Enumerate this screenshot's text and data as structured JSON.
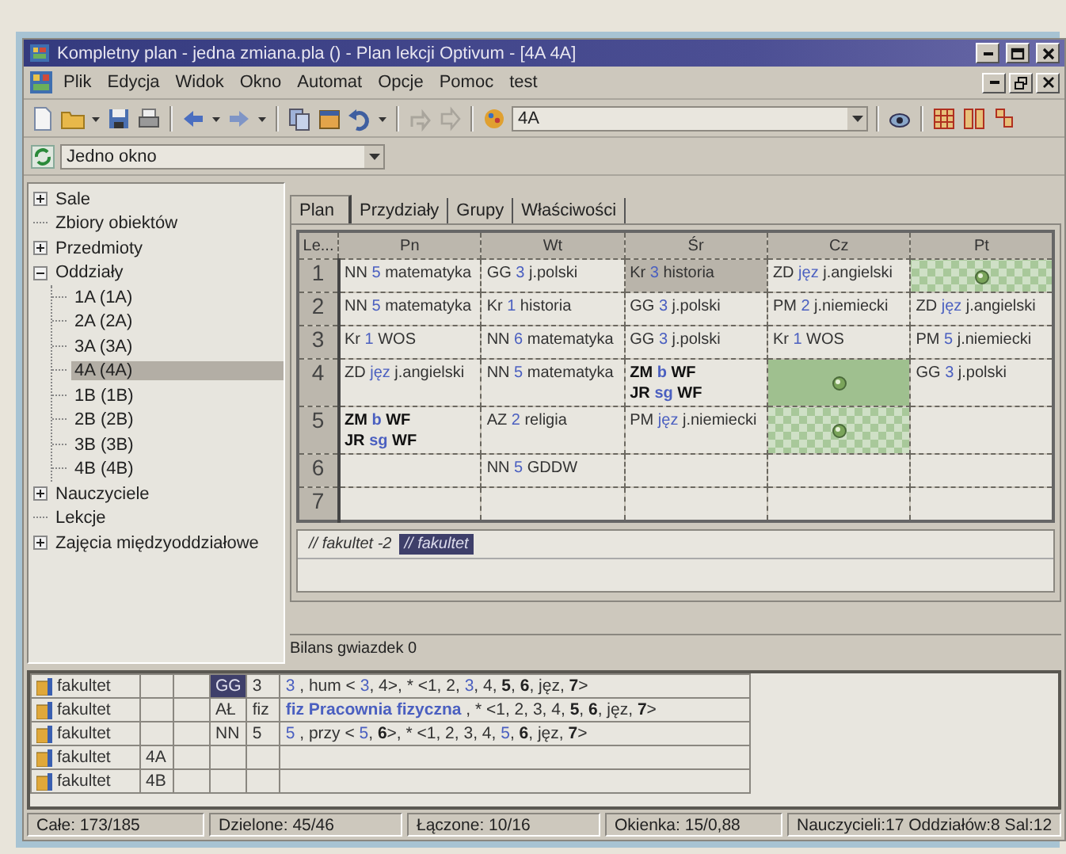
{
  "window": {
    "title": "Kompletny plan - jedna zmiana.pla () - Plan lekcji Optivum - [4A 4A]"
  },
  "menu": [
    "Plik",
    "Edycja",
    "Widok",
    "Okno",
    "Automat",
    "Opcje",
    "Pomoc",
    "test"
  ],
  "toolbar": {
    "class_combo": "4A"
  },
  "toolbar_2": {
    "window_combo": "Jedno okno"
  },
  "tree": {
    "items": [
      {
        "label": "Sale",
        "kind": "group",
        "expanded": false,
        "selected": false
      },
      {
        "label": "Zbiory obiektów",
        "kind": "leaf",
        "selected": false
      },
      {
        "label": "Przedmioty",
        "kind": "group",
        "expanded": false,
        "selected": false
      },
      {
        "label": "Oddziały",
        "kind": "group",
        "expanded": true,
        "selected": false,
        "children": [
          {
            "label": "1A (1A)",
            "selected": false
          },
          {
            "label": "2A (2A)",
            "selected": false
          },
          {
            "label": "3A (3A)",
            "selected": false
          },
          {
            "label": "4A (4A)",
            "selected": true
          },
          {
            "label": "1B (1B)",
            "selected": false
          },
          {
            "label": "2B (2B)",
            "selected": false
          },
          {
            "label": "3B (3B)",
            "selected": false
          },
          {
            "label": "4B (4B)",
            "selected": false
          }
        ]
      },
      {
        "label": "Nauczyciele",
        "kind": "group",
        "expanded": false,
        "selected": false
      },
      {
        "label": "Lekcje",
        "kind": "leaf",
        "selected": false
      },
      {
        "label": "Zajęcia międzyoddziałowe",
        "kind": "group",
        "expanded": false,
        "selected": false
      }
    ]
  },
  "tabs": [
    {
      "label": "Plan",
      "selected": true
    },
    {
      "label": "Przydziały",
      "selected": false
    },
    {
      "label": "Grupy",
      "selected": false
    },
    {
      "label": "Właściwości",
      "selected": false
    }
  ],
  "plan": {
    "corner": "Le...",
    "columns": [
      "Pn",
      "Wt",
      "Śr",
      "Cz",
      "Pt"
    ],
    "rows": [
      {
        "label": "1",
        "cells": [
          {
            "kind": "lesson",
            "selected": false,
            "lines": [
              {
                "teacher": "NN",
                "group": "5",
                "subject": "matematyka",
                "bold": false
              }
            ]
          },
          {
            "kind": "lesson",
            "selected": false,
            "lines": [
              {
                "teacher": "GG",
                "group": "3",
                "subject": "j.polski",
                "bold": false
              }
            ]
          },
          {
            "kind": "lesson",
            "selected": true,
            "lines": [
              {
                "teacher": "Kr",
                "group": "3",
                "subject": "historia",
                "bold": false
              }
            ]
          },
          {
            "kind": "lesson",
            "selected": false,
            "lines": [
              {
                "teacher": "ZD",
                "group": "jęz",
                "subject": "j.angielski",
                "bold": false
              }
            ]
          },
          {
            "kind": "marker",
            "selected": false,
            "checkered": true
          }
        ]
      },
      {
        "label": "2",
        "cells": [
          {
            "kind": "lesson",
            "selected": false,
            "lines": [
              {
                "teacher": "NN",
                "group": "5",
                "subject": "matematyka",
                "bold": false
              }
            ]
          },
          {
            "kind": "lesson",
            "selected": false,
            "lines": [
              {
                "teacher": "Kr",
                "group": "1",
                "subject": "historia",
                "bold": false
              }
            ]
          },
          {
            "kind": "lesson",
            "selected": false,
            "lines": [
              {
                "teacher": "GG",
                "group": "3",
                "subject": "j.polski",
                "bold": false
              }
            ]
          },
          {
            "kind": "lesson",
            "selected": false,
            "lines": [
              {
                "teacher": "PM",
                "group": "2",
                "subject": "j.niemiecki",
                "bold": false
              }
            ]
          },
          {
            "kind": "lesson",
            "selected": false,
            "lines": [
              {
                "teacher": "ZD",
                "group": "jęz",
                "subject": "j.angielski",
                "bold": false
              }
            ]
          }
        ]
      },
      {
        "label": "3",
        "cells": [
          {
            "kind": "lesson",
            "selected": false,
            "lines": [
              {
                "teacher": "Kr",
                "group": "1",
                "subject": "WOS",
                "bold": false
              }
            ]
          },
          {
            "kind": "lesson",
            "selected": false,
            "lines": [
              {
                "teacher": "NN",
                "group": "6",
                "subject": "matematyka",
                "bold": false
              }
            ]
          },
          {
            "kind": "lesson",
            "selected": false,
            "lines": [
              {
                "teacher": "GG",
                "group": "3",
                "subject": "j.polski",
                "bold": false
              }
            ]
          },
          {
            "kind": "lesson",
            "selected": false,
            "lines": [
              {
                "teacher": "Kr",
                "group": "1",
                "subject": "WOS",
                "bold": false
              }
            ]
          },
          {
            "kind": "lesson",
            "selected": false,
            "lines": [
              {
                "teacher": "PM",
                "group": "5",
                "subject": "j.niemiecki",
                "bold": false
              }
            ]
          }
        ]
      },
      {
        "label": "4",
        "cells": [
          {
            "kind": "lesson",
            "selected": false,
            "lines": [
              {
                "teacher": "ZD",
                "group": "jęz",
                "subject": "j.angielski",
                "bold": false
              }
            ]
          },
          {
            "kind": "lesson",
            "selected": false,
            "lines": [
              {
                "teacher": "NN",
                "group": "5",
                "subject": "matematyka",
                "bold": false
              }
            ]
          },
          {
            "kind": "lesson",
            "selected": false,
            "lines": [
              {
                "teacher": "ZM",
                "group": "b",
                "subject": "WF",
                "bold": true
              },
              {
                "teacher": "JR",
                "group": "sg",
                "subject": "WF",
                "bold": true
              }
            ]
          },
          {
            "kind": "marker",
            "selected": false,
            "checkered": false
          },
          {
            "kind": "lesson",
            "selected": false,
            "lines": [
              {
                "teacher": "GG",
                "group": "3",
                "subject": "j.polski",
                "bold": false
              }
            ]
          }
        ]
      },
      {
        "label": "5",
        "cells": [
          {
            "kind": "lesson",
            "selected": false,
            "lines": [
              {
                "teacher": "ZM",
                "group": "b",
                "subject": "WF",
                "bold": true
              },
              {
                "teacher": "JR",
                "group": "sg",
                "subject": "WF",
                "bold": true
              }
            ]
          },
          {
            "kind": "lesson",
            "selected": false,
            "lines": [
              {
                "teacher": "AZ",
                "group": "2",
                "subject": "religia",
                "bold": false
              }
            ]
          },
          {
            "kind": "lesson",
            "selected": false,
            "lines": [
              {
                "teacher": "PM",
                "group": "jęz",
                "subject": "j.niemiecki",
                "bold": false
              }
            ]
          },
          {
            "kind": "marker",
            "selected": false,
            "checkered": true
          },
          {
            "kind": "empty",
            "selected": false
          }
        ]
      },
      {
        "label": "6",
        "cells": [
          {
            "kind": "empty",
            "selected": false
          },
          {
            "kind": "lesson",
            "selected": false,
            "lines": [
              {
                "teacher": "NN",
                "group": "5",
                "subject": "GDDW",
                "bold": false
              }
            ]
          },
          {
            "kind": "empty",
            "selected": false
          },
          {
            "kind": "empty",
            "selected": false
          },
          {
            "kind": "empty",
            "selected": false
          }
        ]
      },
      {
        "label": "7",
        "cells": [
          {
            "kind": "empty",
            "selected": false
          },
          {
            "kind": "empty",
            "selected": false
          },
          {
            "kind": "empty",
            "selected": false
          },
          {
            "kind": "empty",
            "selected": false
          },
          {
            "kind": "empty",
            "selected": false
          }
        ]
      }
    ]
  },
  "sheet_tabs": [
    {
      "label": "// fakultet -2",
      "selected": false
    },
    {
      "label": "// fakultet",
      "selected": true
    }
  ],
  "panel_status": "Bilans gwiazdek 0",
  "group_table": {
    "rows": [
      {
        "name": "fakultet",
        "teacher": "GG",
        "teacher_selected": true,
        "column_5": "3",
        "description": [
          {
            "text": "3",
            "kind": "highlight"
          },
          {
            "text": " , hum < ",
            "kind": "plain"
          },
          {
            "text": "3",
            "kind": "highlight"
          },
          {
            "text": ", 4>, * <1, 2, ",
            "kind": "plain"
          },
          {
            "text": "3",
            "kind": "highlight"
          },
          {
            "text": ", 4, ",
            "kind": "plain"
          },
          {
            "text": "5",
            "kind": "bold"
          },
          {
            "text": ", ",
            "kind": "plain"
          },
          {
            "text": "6",
            "kind": "bold"
          },
          {
            "text": ", jęz, ",
            "kind": "plain"
          },
          {
            "text": "7",
            "kind": "bold"
          },
          {
            "text": ">",
            "kind": "plain"
          }
        ]
      },
      {
        "name": "fakultet",
        "teacher": "AŁ",
        "teacher_selected": false,
        "column_5": "fiz",
        "description": [
          {
            "text": "fiz Pracownia fizyczna",
            "kind": "room"
          },
          {
            "text": " , * <1, 2, 3, 4, ",
            "kind": "plain"
          },
          {
            "text": "5",
            "kind": "bold"
          },
          {
            "text": ", ",
            "kind": "plain"
          },
          {
            "text": "6",
            "kind": "bold"
          },
          {
            "text": ", jęz, ",
            "kind": "plain"
          },
          {
            "text": "7",
            "kind": "bold"
          },
          {
            "text": ">",
            "kind": "plain"
          }
        ]
      },
      {
        "name": "fakultet",
        "teacher": "NN",
        "teacher_selected": false,
        "column_5": "5",
        "description": [
          {
            "text": "5",
            "kind": "highlight"
          },
          {
            "text": " , przy < ",
            "kind": "plain"
          },
          {
            "text": "5",
            "kind": "highlight"
          },
          {
            "text": ", ",
            "kind": "plain"
          },
          {
            "text": "6",
            "kind": "bold"
          },
          {
            "text": ">, * <1, 2, 3, 4, ",
            "kind": "plain"
          },
          {
            "text": "5",
            "kind": "highlight"
          },
          {
            "text": ", ",
            "kind": "plain"
          },
          {
            "text": "6",
            "kind": "bold"
          },
          {
            "text": ", jęz, ",
            "kind": "plain"
          },
          {
            "text": "7",
            "kind": "bold"
          },
          {
            "text": ">",
            "kind": "plain"
          }
        ]
      },
      {
        "name": "fakultet",
        "column_2": "4A",
        "teacher_selected": false
      },
      {
        "name": "fakultet",
        "column_2": "4B",
        "teacher_selected": false
      }
    ]
  },
  "status_bar": [
    "Całe: 173/185",
    "Dzielone: 45/46",
    "Łączone: 10/16",
    "Okienka: 15/0,88",
    "Nauczycieli:17  Oddziałów:8  Sal:12"
  ]
}
